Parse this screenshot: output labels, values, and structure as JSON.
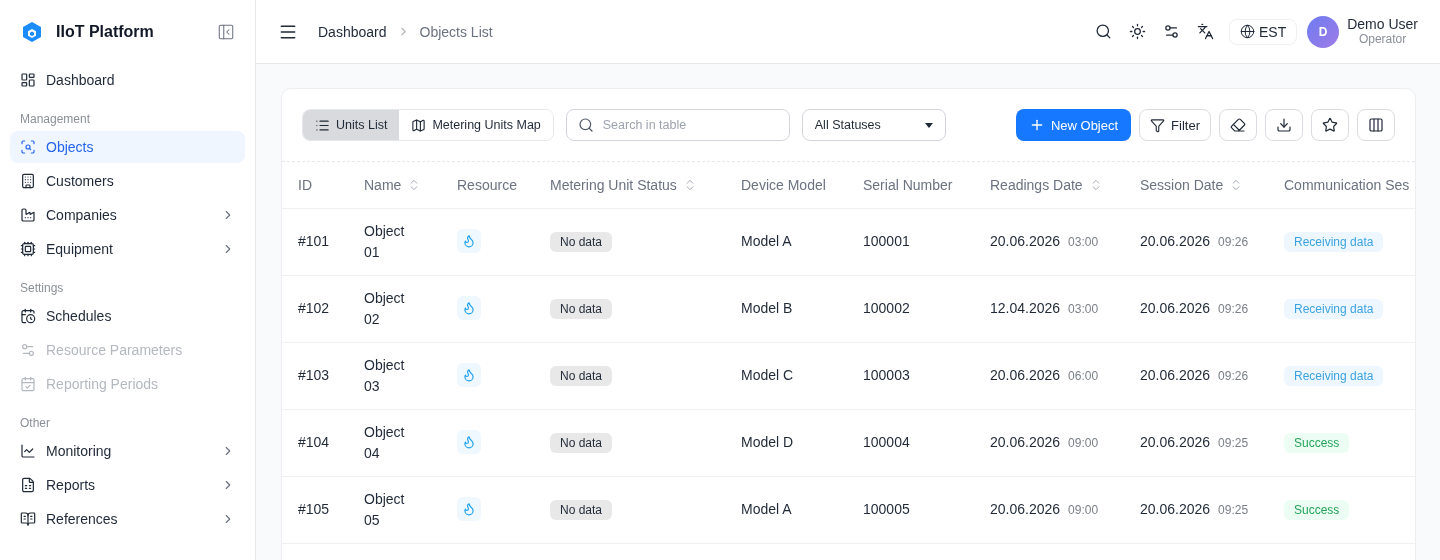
{
  "brand": {
    "name": "IIoT Platform"
  },
  "sidebar": {
    "items": [
      {
        "label": "Dashboard",
        "selected": false,
        "disabled": false,
        "submenu": false
      },
      {
        "section": "Management"
      },
      {
        "label": "Objects",
        "selected": true,
        "disabled": false,
        "submenu": false
      },
      {
        "label": "Customers",
        "selected": false,
        "disabled": false,
        "submenu": false
      },
      {
        "label": "Companies",
        "selected": false,
        "disabled": false,
        "submenu": true
      },
      {
        "label": "Equipment",
        "selected": false,
        "disabled": false,
        "submenu": true
      },
      {
        "section": "Settings"
      },
      {
        "label": "Schedules",
        "selected": false,
        "disabled": false,
        "submenu": false
      },
      {
        "label": "Resource Parameters",
        "selected": false,
        "disabled": true,
        "submenu": false
      },
      {
        "label": "Reporting Periods",
        "selected": false,
        "disabled": true,
        "submenu": false
      },
      {
        "section": "Other"
      },
      {
        "label": "Monitoring",
        "selected": false,
        "disabled": false,
        "submenu": true
      },
      {
        "label": "Reports",
        "selected": false,
        "disabled": false,
        "submenu": true
      },
      {
        "label": "References",
        "selected": false,
        "disabled": false,
        "submenu": true
      }
    ]
  },
  "breadcrumbs": [
    "Dashboard",
    "Objects List"
  ],
  "header": {
    "timezone": "EST",
    "user": {
      "initial": "D",
      "name": "Demo User",
      "role": "Operator"
    }
  },
  "toolbar": {
    "views": [
      {
        "label": "Units List",
        "selected": true
      },
      {
        "label": "Metering Units Map",
        "selected": false
      }
    ],
    "search": {
      "placeholder": "Search in table"
    },
    "status_filter": "All Statuses",
    "new_button": "New Object",
    "filter_button": "Filter"
  },
  "table": {
    "columns": [
      {
        "label": "ID",
        "sortable": false
      },
      {
        "label": "Name",
        "sortable": true
      },
      {
        "label": "Resource",
        "sortable": false
      },
      {
        "label": "Metering Unit Status",
        "sortable": true
      },
      {
        "label": "Device Model",
        "sortable": false
      },
      {
        "label": "Serial Number",
        "sortable": false
      },
      {
        "label": "Readings Date",
        "sortable": true
      },
      {
        "label": "Session Date",
        "sortable": true
      },
      {
        "label": "Communication Ses",
        "sortable": false
      }
    ],
    "rows": [
      {
        "id": "#101",
        "name": "Object 01",
        "status": "No data",
        "model": "Model A",
        "serial": "100001",
        "readings_date": "20.06.2026",
        "readings_time": "03:00",
        "session_date": "20.06.2026",
        "session_time": "09:26",
        "communication": {
          "label": "Receiving data",
          "kind": "info"
        }
      },
      {
        "id": "#102",
        "name": "Object 02",
        "status": "No data",
        "model": "Model B",
        "serial": "100002",
        "readings_date": "12.04.2026",
        "readings_time": "03:00",
        "session_date": "20.06.2026",
        "session_time": "09:26",
        "communication": {
          "label": "Receiving data",
          "kind": "info"
        }
      },
      {
        "id": "#103",
        "name": "Object 03",
        "status": "No data",
        "model": "Model C",
        "serial": "100003",
        "readings_date": "20.06.2026",
        "readings_time": "06:00",
        "session_date": "20.06.2026",
        "session_time": "09:26",
        "communication": {
          "label": "Receiving data",
          "kind": "info"
        }
      },
      {
        "id": "#104",
        "name": "Object 04",
        "status": "No data",
        "model": "Model D",
        "serial": "100004",
        "readings_date": "20.06.2026",
        "readings_time": "09:00",
        "session_date": "20.06.2026",
        "session_time": "09:25",
        "communication": {
          "label": "Success",
          "kind": "success"
        }
      },
      {
        "id": "#105",
        "name": "Object 05",
        "status": "No data",
        "model": "Model A",
        "serial": "100005",
        "readings_date": "20.06.2026",
        "readings_time": "09:00",
        "session_date": "20.06.2026",
        "session_time": "09:25",
        "communication": {
          "label": "Success",
          "kind": "success"
        }
      }
    ]
  }
}
